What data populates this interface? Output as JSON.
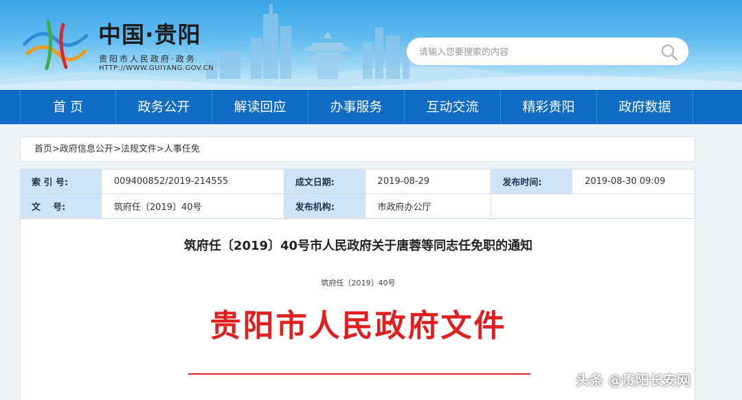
{
  "header": {
    "title": "中国·贵阳",
    "subtitle": "贵阳市人民政府·政务",
    "url": "HTTP://WWW.GUIYANG.GOV.CN",
    "search_placeholder": "请输入您要搜索的内容"
  },
  "nav": {
    "items": [
      "首 页",
      "政务公开",
      "解读回应",
      "办事服务",
      "互动交流",
      "精彩贵阳",
      "政府数据"
    ]
  },
  "breadcrumb": [
    "首页",
    "政府信息公开",
    "法规文件",
    "人事任免"
  ],
  "breadcrumb_sep": ">",
  "meta": {
    "index_label": "索 引 号:",
    "index_value": "009400852/2019-214555",
    "date_label": "成文日期:",
    "date_value": "2019-08-29",
    "publish_label": "发布时间:",
    "publish_value": "2019-08-30 09:09",
    "doc_label": "文    号:",
    "doc_value": "筑府任〔2019〕40号",
    "org_label": "发布机构:",
    "org_value": "市政府办公厅"
  },
  "article": {
    "title": "筑府任〔2019〕40号市人民政府关于唐蓉等同志任免职的通知",
    "doc_number": "筑府任〔2019〕40号",
    "red_header": "贵阳市人民政府文件"
  },
  "watermark": "头条 @贵阳长安网",
  "colors": {
    "nav": "#0e6cc4",
    "label_bg": "#cfe4f6",
    "red": "#e02020"
  }
}
